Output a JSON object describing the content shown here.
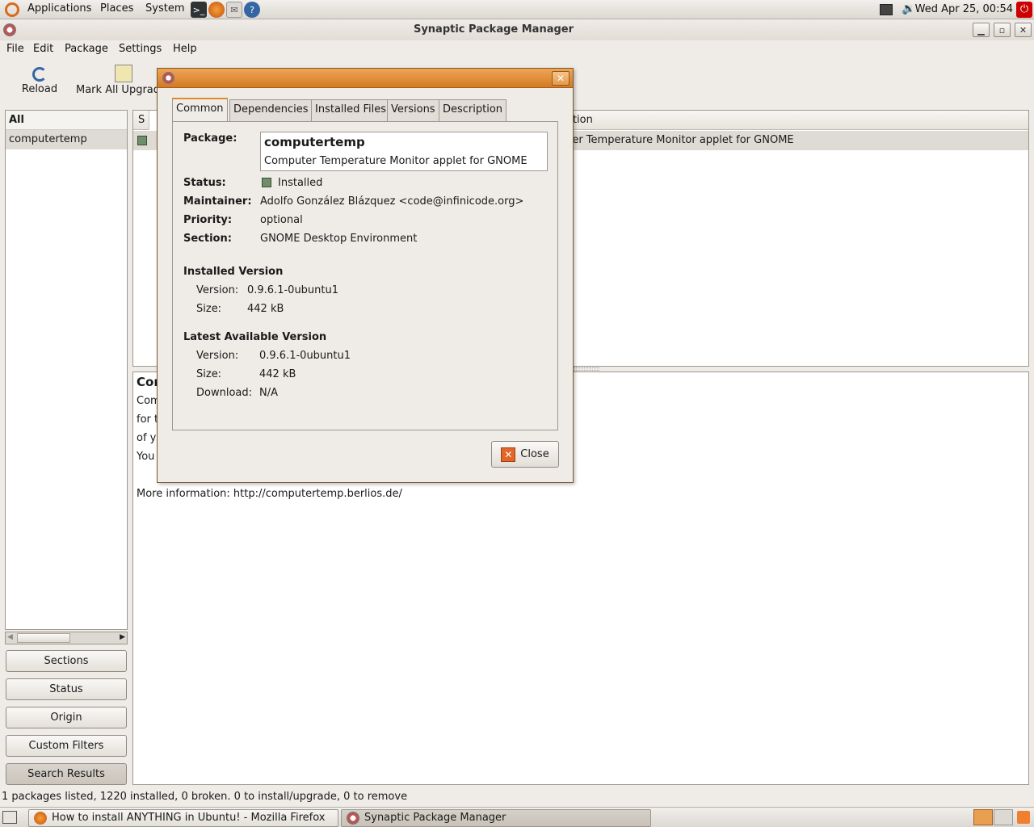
{
  "top_panel": {
    "menus": [
      "Applications",
      "Places",
      "System"
    ],
    "clock": "Wed Apr 25, 00:54"
  },
  "window": {
    "title": "Synaptic Package Manager"
  },
  "menubar": {
    "items": [
      "File",
      "Edit",
      "Package",
      "Settings",
      "Help"
    ]
  },
  "toolbar": {
    "reload": "Reload",
    "mark_all": "Mark All Upgrad"
  },
  "sidebar": {
    "header": "All",
    "selected_item": "computertemp",
    "buttons": [
      "Sections",
      "Status",
      "Origin",
      "Custom Filters",
      "Search Results"
    ]
  },
  "package_list": {
    "col_status": "S",
    "col_desc": "otion",
    "row_desc": "uter Temperature Monitor applet for GNOME"
  },
  "description_pane": {
    "heading": "Cor",
    "lines": [
      "Com",
      "for t",
      "of yo",
      "You"
    ],
    "more_info": "More information: http://computertemp.berlios.de/"
  },
  "statusbar": {
    "text": "1 packages listed, 1220 installed, 0 broken. 0 to install/upgrade, 0 to remove"
  },
  "taskbar": {
    "firefox_task": "How to install ANYTHING in Ubuntu! - Mozilla Firefox",
    "synaptic_task": "Synaptic Package Manager"
  },
  "dialog": {
    "tabs": [
      "Common",
      "Dependencies",
      "Installed Files",
      "Versions",
      "Description"
    ],
    "package_label": "Package:",
    "package_name": "computertemp",
    "package_summary": "Computer Temperature Monitor applet for GNOME",
    "status_label": "Status:",
    "status_value": "Installed",
    "maintainer_label": "Maintainer:",
    "maintainer_value": "Adolfo González Blázquez <code@infinicode.org>",
    "priority_label": "Priority:",
    "priority_value": "optional",
    "section_label": "Section:",
    "section_value": "GNOME Desktop Environment",
    "installed_heading": "Installed Version",
    "installed_version_label": "Version:",
    "installed_version_value": "0.9.6.1-0ubuntu1",
    "installed_size_label": "Size:",
    "installed_size_value": "442 kB",
    "latest_heading": "Latest Available Version",
    "latest_version_label": "Version:",
    "latest_version_value": "0.9.6.1-0ubuntu1",
    "latest_size_label": "Size:",
    "latest_size_value": "442 kB",
    "download_label": "Download:",
    "download_value": "N/A",
    "close_label": "Close"
  },
  "colors": {
    "dialog_titlebar": "#e08a2c",
    "installed_status": "#6f8f6a"
  }
}
